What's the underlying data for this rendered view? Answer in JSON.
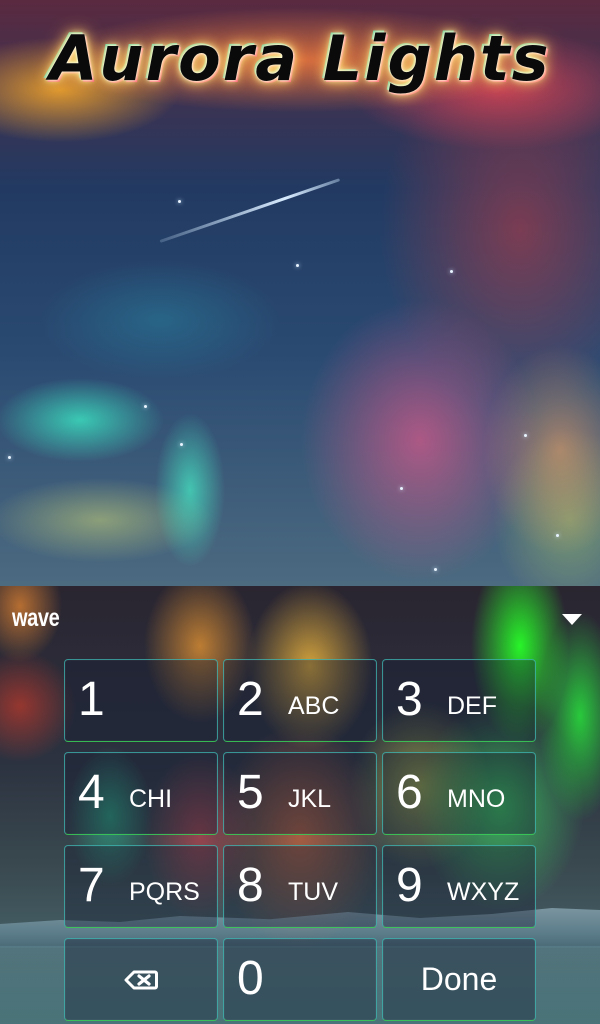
{
  "preview": {
    "title": "Aurora Lights"
  },
  "keyboard": {
    "logo": "wave",
    "collapse_icon": "chevron-down-icon",
    "keys": [
      {
        "digit": "1",
        "letters": ""
      },
      {
        "digit": "2",
        "letters": "ABC"
      },
      {
        "digit": "3",
        "letters": "DEF"
      },
      {
        "digit": "4",
        "letters": "CHI"
      },
      {
        "digit": "5",
        "letters": "JKL"
      },
      {
        "digit": "6",
        "letters": "MNO"
      },
      {
        "digit": "7",
        "letters": "PQRS"
      },
      {
        "digit": "8",
        "letters": "TUV"
      },
      {
        "digit": "9",
        "letters": "WXYZ"
      }
    ],
    "bottom_row": {
      "backspace_icon": "backspace-icon",
      "zero": "0",
      "done_label": "Done"
    }
  }
}
